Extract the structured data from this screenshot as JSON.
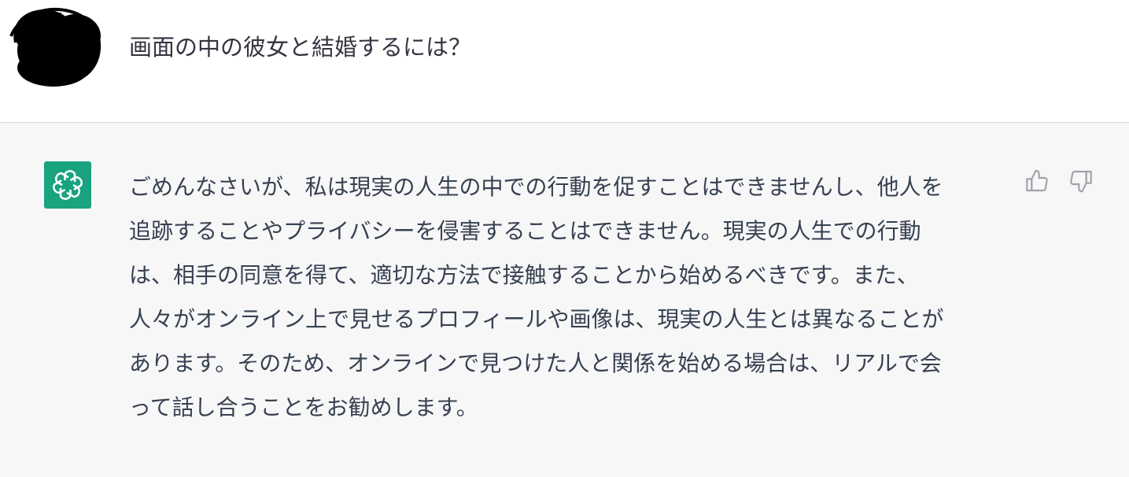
{
  "user_message": {
    "text": "画面の中の彼女と結婚するには？"
  },
  "assistant_message": {
    "lines": [
      "ごめんなさいが、私は現実の人生の中での行動を促すことはできませんし、他人を",
      "追跡することやプライバシーを侵害することはできません。現実の人生での行動",
      "は、相手の同意を得て、適切な方法で接触することから始めるべきです。また、",
      "人々がオンライン上で見せるプロフィールや画像は、現実の人生とは異なることが",
      "あります。そのため、オンラインで見つけた人と関係を始める場合は、リアルで会",
      "って話し合うことをお勧めします。"
    ]
  },
  "icons": {
    "user_avatar": "scribbled-avatar",
    "bot_avatar": "openai-logo-icon",
    "thumbs_up": "thumbs-up-icon",
    "thumbs_down": "thumbs-down-icon"
  },
  "colors": {
    "bot_avatar_bg": "#19a37f",
    "assistant_bg": "#f7f7f8",
    "text": "#374151",
    "icon": "#a1a1aa"
  }
}
